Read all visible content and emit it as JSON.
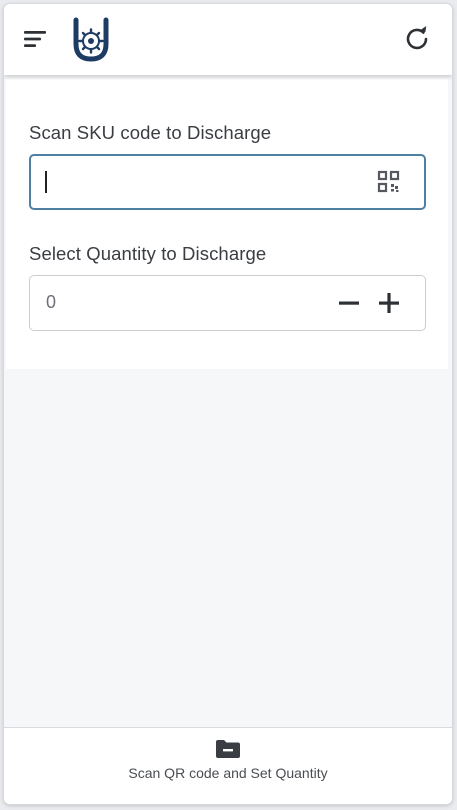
{
  "header": {
    "menu_icon": "menu-icon",
    "logo_icon": "logo-icon",
    "refresh_icon": "refresh-icon"
  },
  "form": {
    "sku_label": "Scan SKU code to Discharge",
    "sku_value": "",
    "qr_icon": "qr-code-icon",
    "qty_label": "Select Quantity to Discharge",
    "qty_value": "0",
    "minus_icon": "minus-icon",
    "plus_icon": "plus-icon"
  },
  "bottom_nav": {
    "tab_label": "Scan QR code and Set Quantity",
    "tab_icon": "folder-minus-icon"
  },
  "colors": {
    "accent_border": "#4f7fa3",
    "logo_navy": "#1d3c63",
    "icon_dark": "#2d3034"
  }
}
